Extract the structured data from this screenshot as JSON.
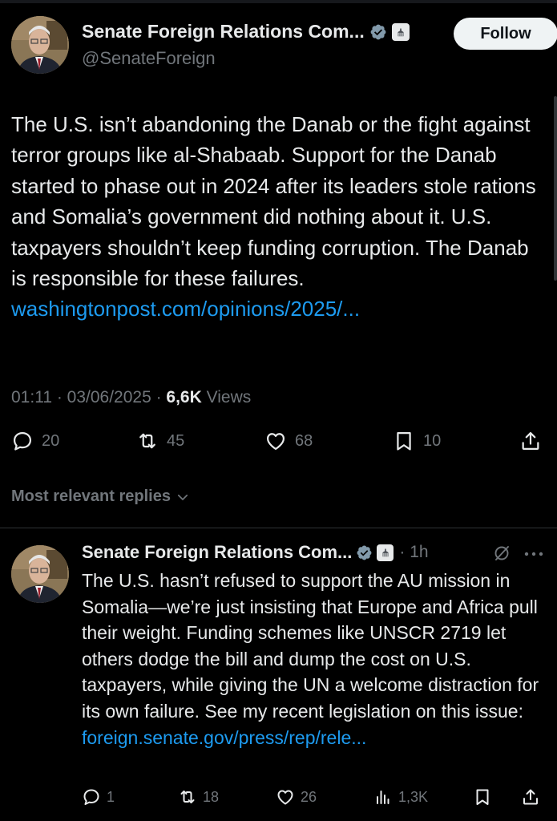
{
  "main_tweet": {
    "author_name": "Senate Foreign Relations Com...",
    "handle": "@SenateForeign",
    "follow_label": "Follow",
    "text": "The U.S. isn’t abandoning the Danab or the fight against terror groups like al-Shabaab. Support for the Danab started to phase out in 2024 after its leaders stole rations and Somalia’s government did nothing about it. U.S. taxpayers shouldn’t keep funding corruption. The Danab is responsible for these failures. ",
    "link": "washingtonpost.com/opinions/​2025/...",
    "timestamp": "01:11 · 03/06/2025 · ",
    "views_count": "6,6K",
    "views_label": " Views",
    "replies": "20",
    "reposts": "45",
    "likes": "68",
    "bookmarks": "10"
  },
  "replies_header": {
    "label": "Most relevant replies"
  },
  "reply_tweet": {
    "author_name": "Senate Foreign Relations Com...",
    "time": "· 1h",
    "text": "The U.S. hasn’t refused to support the AU mission in Somalia—we’re just insisting that Europe and Africa pull their weight. Funding schemes like UNSCR 2719 let others dodge the bill and dump the cost on U.S. taxpayers, while giving the UN a welcome distraction for its own failure. See my recent legislation on this issue: ",
    "link": "foreign.senate.gov/​press/rep/rele...",
    "replies": "1",
    "reposts": "18",
    "likes": "26",
    "views": "1,3K"
  },
  "colors": {
    "background": "#000000",
    "text": "#e7e9ea",
    "muted": "#71767b",
    "link": "#1d9bf0",
    "verified": "#829aab"
  },
  "icons": [
    "verified-badge-icon",
    "government-building-icon",
    "reply-icon",
    "repost-icon",
    "like-icon",
    "bookmark-icon",
    "share-icon",
    "chevron-down-icon",
    "grok-icon",
    "more-icon",
    "views-icon"
  ]
}
